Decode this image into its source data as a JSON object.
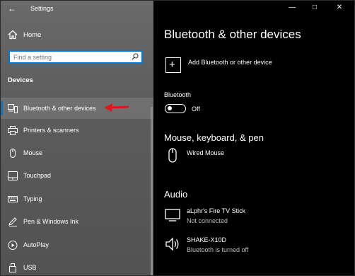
{
  "window": {
    "title": "Settings"
  },
  "sidebar": {
    "home_label": "Home",
    "search_placeholder": "Find a setting",
    "section_title": "Devices",
    "items": [
      {
        "label": "Bluetooth & other devices",
        "icon": "bluetooth-devices-icon",
        "selected": true
      },
      {
        "label": "Printers & scanners",
        "icon": "printer-icon"
      },
      {
        "label": "Mouse",
        "icon": "mouse-icon"
      },
      {
        "label": "Touchpad",
        "icon": "touchpad-icon"
      },
      {
        "label": "Typing",
        "icon": "keyboard-icon"
      },
      {
        "label": "Pen & Windows Ink",
        "icon": "pen-icon"
      },
      {
        "label": "AutoPlay",
        "icon": "autoplay-icon"
      },
      {
        "label": "USB",
        "icon": "usb-icon"
      }
    ]
  },
  "main": {
    "title": "Bluetooth & other devices",
    "add_label": "Add Bluetooth or other device",
    "bluetooth_label": "Bluetooth",
    "bluetooth_state": "Off",
    "section_mouse": "Mouse, keyboard, & pen",
    "mouse_device": "Wired Mouse",
    "section_audio": "Audio",
    "audio_devices": [
      {
        "name": "aLphr's Fire TV Stick",
        "status": "Not connected",
        "icon": "display-icon"
      },
      {
        "name": "SHAKE-X10D",
        "status": "Bluetooth is turned off",
        "icon": "speaker-icon"
      }
    ]
  },
  "colors": {
    "accent": "#0078d7",
    "annotation_arrow": "#e0161b"
  }
}
